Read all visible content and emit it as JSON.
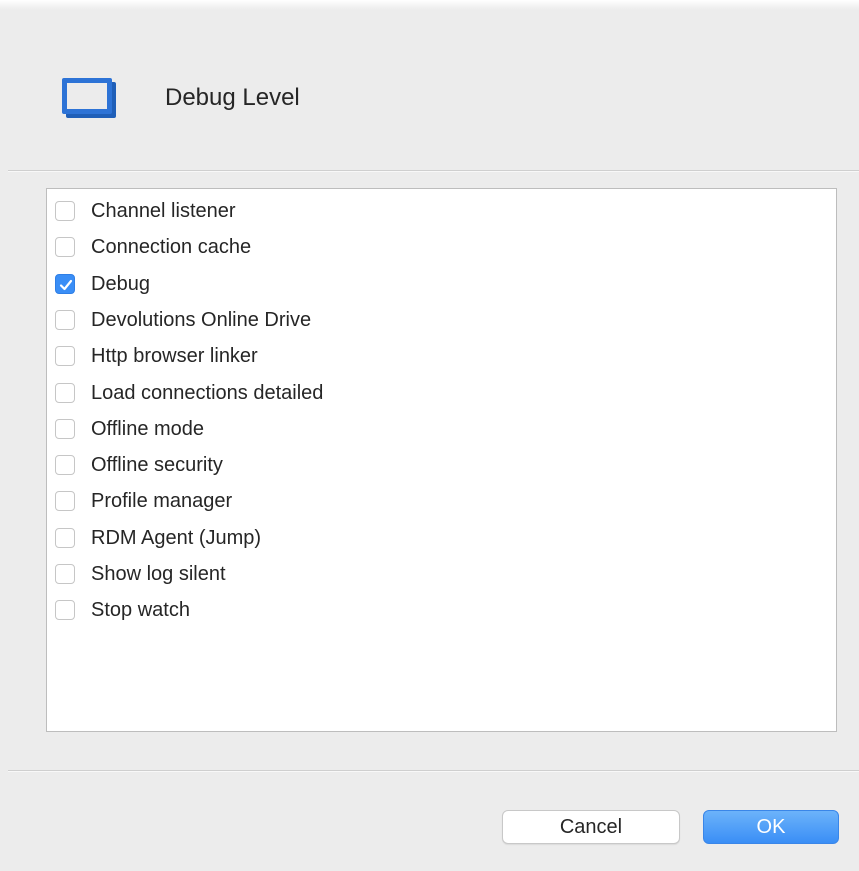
{
  "dialog": {
    "title": "Debug Level",
    "icon": "window-icon",
    "accent_color": "#3a8ef6"
  },
  "list": {
    "items": [
      {
        "label": "Channel listener",
        "checked": false
      },
      {
        "label": "Connection cache",
        "checked": false
      },
      {
        "label": "Debug",
        "checked": true
      },
      {
        "label": "Devolutions Online Drive",
        "checked": false
      },
      {
        "label": "Http browser linker",
        "checked": false
      },
      {
        "label": "Load connections detailed",
        "checked": false
      },
      {
        "label": "Offline mode",
        "checked": false
      },
      {
        "label": "Offline security",
        "checked": false
      },
      {
        "label": "Profile manager",
        "checked": false
      },
      {
        "label": "RDM Agent (Jump)",
        "checked": false
      },
      {
        "label": "Show log silent",
        "checked": false
      },
      {
        "label": "Stop watch",
        "checked": false
      }
    ]
  },
  "buttons": {
    "cancel_label": "Cancel",
    "ok_label": "OK"
  }
}
